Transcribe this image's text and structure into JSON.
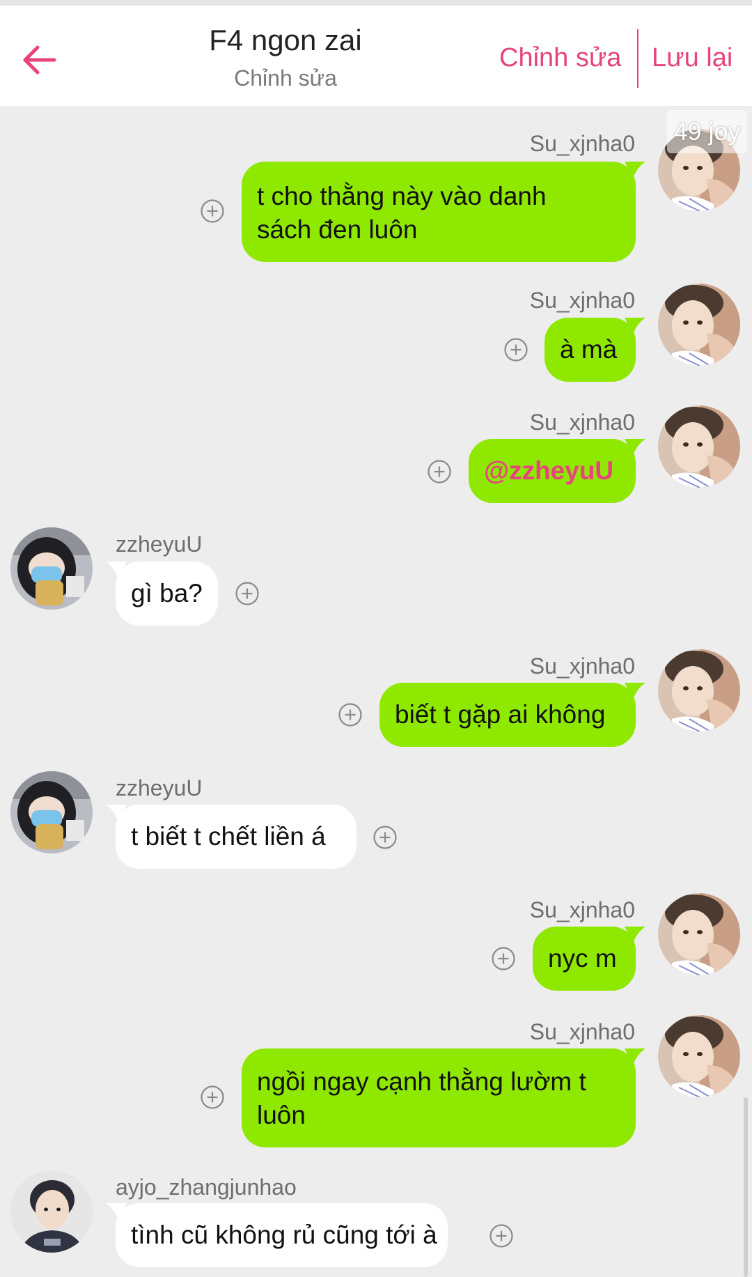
{
  "header": {
    "back_icon": "arrow-left-icon",
    "title": "F4 ngon zai",
    "subtitle": "Chỉnh sửa",
    "edit_label": "Chỉnh sửa",
    "save_label": "Lưu lại",
    "accent_color": "#e8437f"
  },
  "overlay": {
    "joy_badge": "49 joy"
  },
  "colors": {
    "my_bubble": "#8fe800",
    "other_bubble": "#ffffff",
    "background": "#ededed"
  },
  "messages": [
    {
      "sender": "Su_xjnha0",
      "text_line1": "t cho thằng này vào danh",
      "text_line2": "sách đen luôn"
    },
    {
      "sender": "Su_xjnha0",
      "text": "à mà"
    },
    {
      "sender": "Su_xjnha0",
      "text": "@zzheyuU"
    },
    {
      "sender": "zzheyuU",
      "text": "gì ba?"
    },
    {
      "sender": "Su_xjnha0",
      "text": "biết t gặp ai không"
    },
    {
      "sender": "zzheyuU",
      "text": "t biết t chết liền á"
    },
    {
      "sender": "Su_xjnha0",
      "text": "nyc m"
    },
    {
      "sender": "Su_xjnha0",
      "text_line1": "ngồi ngay cạnh thằng lườm t",
      "text_line2": "luôn"
    },
    {
      "sender": "ayjo_zhangjunhao",
      "text": "tình cũ không rủ cũng tới à"
    }
  ]
}
